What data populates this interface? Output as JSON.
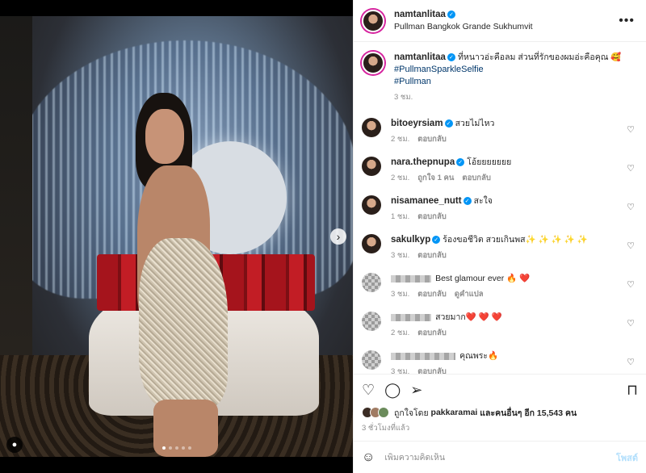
{
  "post": {
    "author": "namtanlitaa",
    "location": "Pullman Bangkok Grande Sukhumvit",
    "caption": "ที่หนาวอ่ะคือลม ส่วนที่รักของผมอ่ะคือคุณ 🥰",
    "hashtags": [
      "#PullmanSparkleSelfie",
      "#Pullman"
    ],
    "caption_time": "3 ชม.",
    "slide_count": 5,
    "active_slide": 0
  },
  "comments": [
    {
      "user": "bitoeyrsiam",
      "verified": true,
      "text": "สวยไม่ไหว",
      "time": "2 ชม.",
      "likes": "",
      "reply": "ตอบกลับ",
      "translate": ""
    },
    {
      "user": "nara.thepnupa",
      "verified": true,
      "text": "โอ้ยยยยยยย",
      "time": "2 ชม.",
      "likes": "ถูกใจ 1 คน",
      "reply": "ตอบกลับ",
      "translate": ""
    },
    {
      "user": "nisamanee_nutt",
      "verified": true,
      "text": "สะใจ",
      "time": "1 ชม.",
      "likes": "",
      "reply": "ตอบกลับ",
      "translate": ""
    },
    {
      "user": "sakulkyp",
      "verified": true,
      "text": "ร้องขอชีวิต สวยเกินพส✨ ✨ ✨ ✨ ✨",
      "time": "3 ชม.",
      "likes": "",
      "reply": "ตอบกลับ",
      "translate": ""
    },
    {
      "user": "",
      "verified": false,
      "text": "Best glamour ever 🔥 ❤️",
      "time": "3 ชม.",
      "likes": "",
      "reply": "ตอบกลับ",
      "translate": "ดูคำแปล"
    },
    {
      "user": "",
      "verified": false,
      "text": "สวยมาก❤️ ❤️ ❤️",
      "time": "2 ชม.",
      "likes": "",
      "reply": "ตอบกลับ",
      "translate": ""
    },
    {
      "user": "",
      "verified": false,
      "text": "คุณพระ🔥",
      "time": "3 ชม.",
      "likes": "",
      "reply": "ตอบกลับ",
      "translate": ""
    }
  ],
  "footer": {
    "liked_by_prefix": "ถูกใจโดย",
    "liked_by_user": "pakkaramai",
    "liked_by_rest": "และคนอื่นๆ อีก 15,543 คน",
    "time_ago": "3 ชั่วโมงที่แล้ว",
    "comment_placeholder": "เพิ่มความคิดเห็น",
    "post_label": "โพสต์"
  },
  "icons": {
    "more": "more-icon",
    "heart": "heart-icon",
    "comment": "comment-icon",
    "share": "share-icon",
    "save": "bookmark-icon",
    "emoji": "emoji-icon",
    "next": "chevron-right-icon",
    "tag": "user-tag-icon"
  },
  "colors": {
    "verified": "#0095f6",
    "link": "#00376b",
    "muted": "#8e8e8e",
    "post_disabled": "#b2dffc"
  }
}
